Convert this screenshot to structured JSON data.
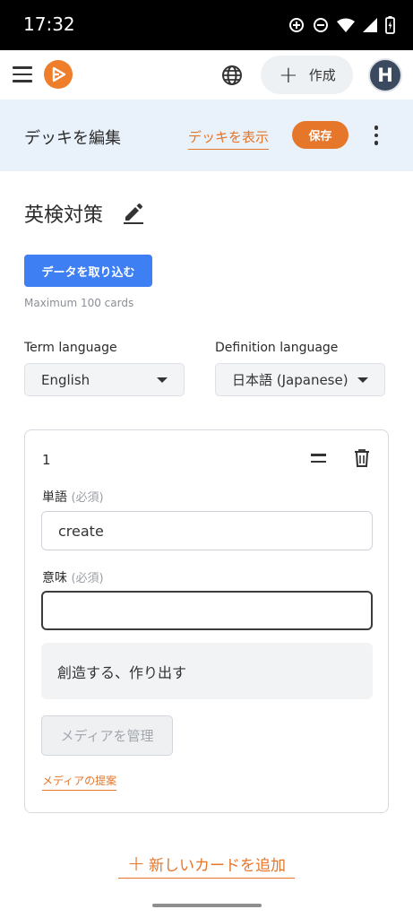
{
  "status_bar": {
    "time": "17:32"
  },
  "app_bar": {
    "create_label": "作成",
    "avatar_initial": "H",
    "brand_color": "#ef7e2a"
  },
  "edit_bar": {
    "title": "デッキを編集",
    "show_deck_label": "デッキを表示",
    "save_label": "保存"
  },
  "deck": {
    "name": "英検対策",
    "import_label": "データを取り込む",
    "max_cards_note": "Maximum 100 cards"
  },
  "languages": {
    "term_label": "Term language",
    "term_value": "English",
    "definition_label": "Definition language",
    "definition_value": "日本語 (Japanese)"
  },
  "card": {
    "number": "1",
    "term_label": "単語",
    "term_required": "(必須)",
    "term_value": "create",
    "definition_label": "意味",
    "definition_required": "(必須)",
    "definition_value": "",
    "suggestion": "創造する、作り出す",
    "manage_media_label": "メディアを管理",
    "suggest_media_label": "メディアの提案"
  },
  "add_card_label": "新しいカードを追加",
  "colors": {
    "accent_orange": "#e5762a",
    "primary_blue": "#3e7ff3",
    "header_bg": "#e9f1fb"
  }
}
